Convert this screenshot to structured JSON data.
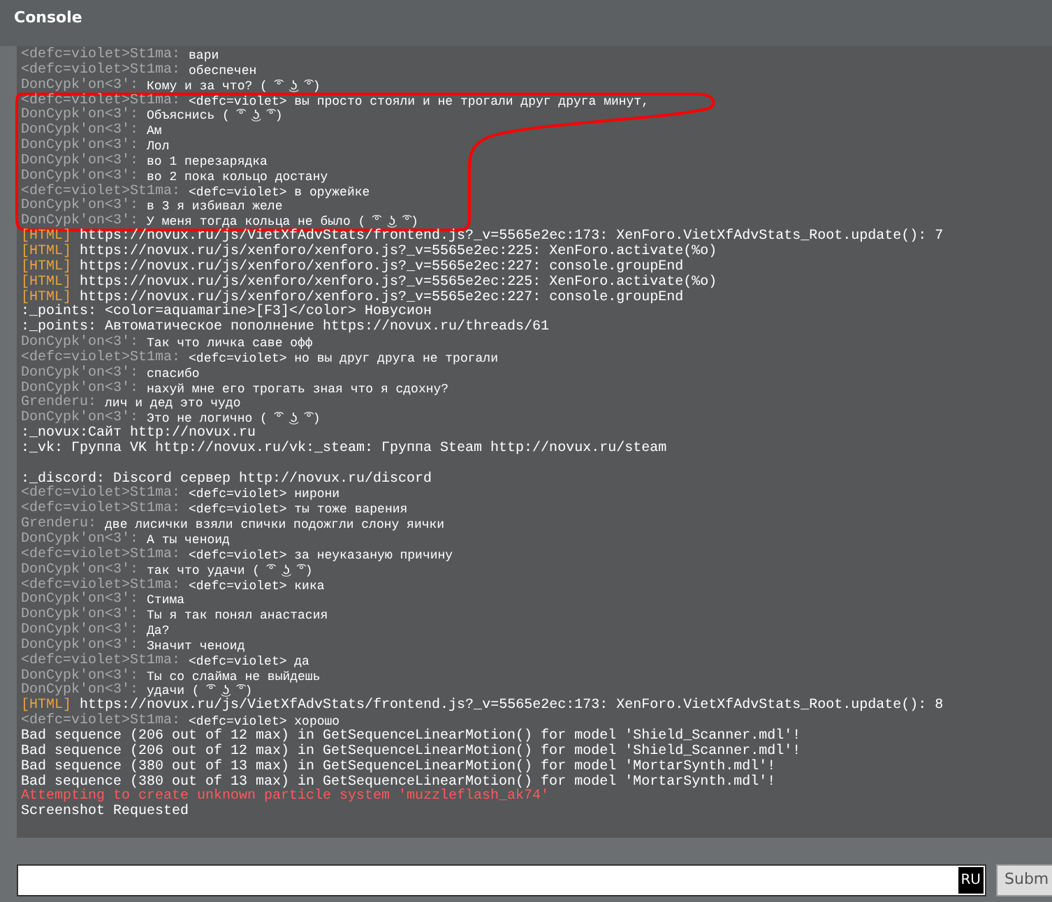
{
  "window": {
    "title": "Console"
  },
  "annotations": [
    {
      "kind": "freehand-loop",
      "color": "#ff0000"
    }
  ],
  "log": [
    {
      "kind": "chat",
      "speaker": "<defc=violet>St1ma:",
      "text": "вари"
    },
    {
      "kind": "chat",
      "speaker": "<defc=violet>St1ma:",
      "text": "обеспечен"
    },
    {
      "kind": "chat",
      "speaker": "DonCypk'on<3':",
      "text": "Кому и за что? ( ͡° ͜ʖ ͡°)"
    },
    {
      "kind": "chat",
      "speaker": "<defc=violet>St1ma:",
      "text": "<defc=violet> вы просто стояли и не трогали друг друга минут,"
    },
    {
      "kind": "chat",
      "speaker": "DonCypk'on<3':",
      "text": "Объяснись ( ͡° ͜ʖ ͡°)"
    },
    {
      "kind": "chat",
      "speaker": "DonCypk'on<3':",
      "text": "Ам"
    },
    {
      "kind": "chat",
      "speaker": "DonCypk'on<3':",
      "text": "Лол"
    },
    {
      "kind": "chat",
      "speaker": "DonCypk'on<3':",
      "text": "во 1 перезарядка"
    },
    {
      "kind": "chat",
      "speaker": "DonCypk'on<3':",
      "text": "во 2 пока кольцо достану"
    },
    {
      "kind": "chat",
      "speaker": "<defc=violet>St1ma:",
      "text": "<defc=violet> в оружейке"
    },
    {
      "kind": "chat",
      "speaker": "DonCypk'on<3':",
      "text": "в 3 я избивал желе"
    },
    {
      "kind": "chat",
      "speaker": "DonCypk'on<3':",
      "text": "У меня тогда кольца не было ( ͡° ͜ʖ ͡°)"
    },
    {
      "kind": "html",
      "tag": "[HTML]",
      "text": "https://novux.ru/js/VietXfAdvStats/frontend.js?_v=5565e2ec:173: XenForo.VietXfAdvStats_Root.update(): 7"
    },
    {
      "kind": "html",
      "tag": "[HTML]",
      "text": "https://novux.ru/js/xenforo/xenforo.js?_v=5565e2ec:225: XenForo.activate(%o)"
    },
    {
      "kind": "html",
      "tag": "[HTML]",
      "text": "https://novux.ru/js/xenforo/xenforo.js?_v=5565e2ec:227: console.groupEnd"
    },
    {
      "kind": "html",
      "tag": "[HTML]",
      "text": "https://novux.ru/js/xenforo/xenforo.js?_v=5565e2ec:225: XenForo.activate(%o)"
    },
    {
      "kind": "html",
      "tag": "[HTML]",
      "text": "https://novux.ru/js/xenforo/xenforo.js?_v=5565e2ec:227: console.groupEnd"
    },
    {
      "kind": "plain",
      "text": ":_points: <color=aquamarine>[F3]</color> Новусион"
    },
    {
      "kind": "plain",
      "text": ":_points: Автоматическое пополнение https://novux.ru/threads/61"
    },
    {
      "kind": "chat",
      "speaker": "DonCypk'on<3':",
      "text": "Так что личка саве офф"
    },
    {
      "kind": "chat",
      "speaker": "<defc=violet>St1ma:",
      "text": "<defc=violet> но вы друг друга не трогали"
    },
    {
      "kind": "chat",
      "speaker": "DonCypk'on<3':",
      "text": "спасибо"
    },
    {
      "kind": "chat",
      "speaker": "DonCypk'on<3':",
      "text": "нахуй мне его трогать зная что я сдохну?"
    },
    {
      "kind": "chat",
      "speaker": "Grenderu:",
      "text": "лич и дед это чудо"
    },
    {
      "kind": "chat",
      "speaker": "DonCypk'on<3':",
      "text": "Это не логично ( ͡° ͜ʖ ͡°)"
    },
    {
      "kind": "plain",
      "text": ":_novux:Сайт http://novux.ru"
    },
    {
      "kind": "plain",
      "text": ":_vk: Группа VK http://novux.ru/vk:_steam: Группа Steam http://novux.ru/steam"
    },
    {
      "kind": "blank"
    },
    {
      "kind": "plain",
      "text": ":_discord: Discord сервер http://novux.ru/discord"
    },
    {
      "kind": "chat",
      "speaker": "<defc=violet>St1ma:",
      "text": "<defc=violet> нирони"
    },
    {
      "kind": "chat",
      "speaker": "<defc=violet>St1ma:",
      "text": "<defc=violet> ты тоже варения"
    },
    {
      "kind": "chat",
      "speaker": "Grenderu:",
      "text": "две лисички взяли спички подожгли слону яички"
    },
    {
      "kind": "chat",
      "speaker": "DonCypk'on<3':",
      "text": "А ты ченоид"
    },
    {
      "kind": "chat",
      "speaker": "<defc=violet>St1ma:",
      "text": "<defc=violet> за неуказаную причину"
    },
    {
      "kind": "chat",
      "speaker": "DonCypk'on<3':",
      "text": "так что удачи ( ͡° ͜ʖ ͡°)"
    },
    {
      "kind": "chat",
      "speaker": "<defc=violet>St1ma:",
      "text": "<defc=violet> кика"
    },
    {
      "kind": "chat",
      "speaker": "DonCypk'on<3':",
      "text": "Стима"
    },
    {
      "kind": "chat",
      "speaker": "DonCypk'on<3':",
      "text": "Ты я так понял анастасия"
    },
    {
      "kind": "chat",
      "speaker": "DonCypk'on<3':",
      "text": "Да?"
    },
    {
      "kind": "chat",
      "speaker": "DonCypk'on<3':",
      "text": "Значит ченоид"
    },
    {
      "kind": "chat",
      "speaker": "<defc=violet>St1ma:",
      "text": "<defc=violet> да"
    },
    {
      "kind": "chat",
      "speaker": "DonCypk'on<3':",
      "text": "Ты со слайма не выйдешь"
    },
    {
      "kind": "chat",
      "speaker": "DonCypk'on<3':",
      "text": "удачи ( ͡° ͜ʖ ͡°)"
    },
    {
      "kind": "html",
      "tag": "[HTML]",
      "text": "https://novux.ru/js/VietXfAdvStats/frontend.js?_v=5565e2ec:173: XenForo.VietXfAdvStats_Root.update(): 8"
    },
    {
      "kind": "chat",
      "speaker": "<defc=violet>St1ma:",
      "text": "<defc=violet> хорошо"
    },
    {
      "kind": "plain",
      "text": "Bad sequence (206 out of 12 max) in GetSequenceLinearMotion() for model 'Shield_Scanner.mdl'!"
    },
    {
      "kind": "plain",
      "text": "Bad sequence (206 out of 12 max) in GetSequenceLinearMotion() for model 'Shield_Scanner.mdl'!"
    },
    {
      "kind": "plain",
      "text": "Bad sequence (380 out of 13 max) in GetSequenceLinearMotion() for model 'MortarSynth.mdl'!"
    },
    {
      "kind": "plain",
      "text": "Bad sequence (380 out of 13 max) in GetSequenceLinearMotion() for model 'MortarSynth.mdl'!"
    },
    {
      "kind": "error",
      "text": "Attempting to create unknown particle system 'muzzleflash_ak74'"
    },
    {
      "kind": "plain",
      "text": "Screenshot Requested"
    }
  ],
  "input": {
    "language": "RU"
  },
  "buttons": [
    {
      "label": "Subm"
    }
  ]
}
